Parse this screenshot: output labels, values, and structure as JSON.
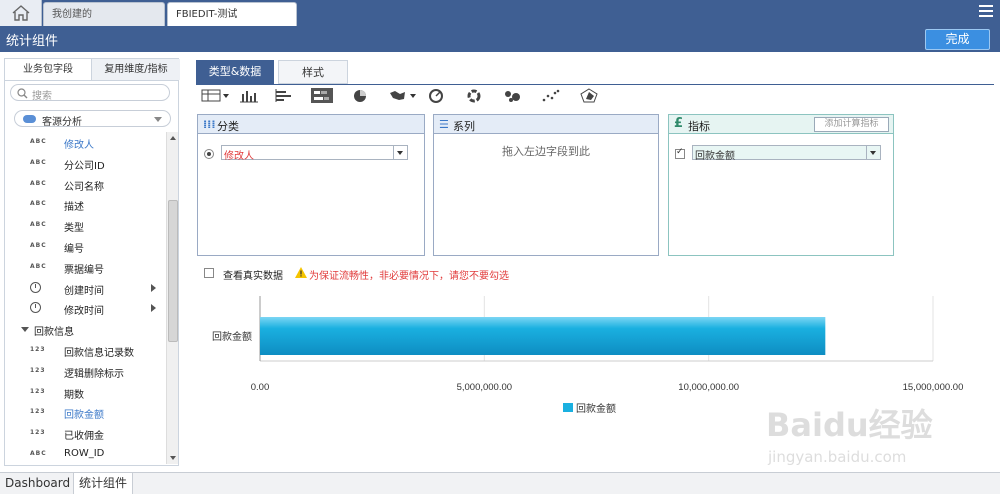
{
  "tabs": [
    {
      "label": "我创建的"
    },
    {
      "label": "FBIEDIT-测试"
    }
  ],
  "title": "统计组件",
  "done_label": "完成",
  "left": {
    "tabs": [
      "业务包字段",
      "复用维度/指标"
    ],
    "search_placeholder": "搜索",
    "package": "客源分析",
    "fields": [
      {
        "kind": "ABC",
        "name": "修改人",
        "highlight": true
      },
      {
        "kind": "ABC",
        "name": "分公司ID"
      },
      {
        "kind": "ABC",
        "name": "公司名称"
      },
      {
        "kind": "ABC",
        "name": "描述"
      },
      {
        "kind": "ABC",
        "name": "类型"
      },
      {
        "kind": "ABC",
        "name": "编号"
      },
      {
        "kind": "ABC",
        "name": "票据编号"
      },
      {
        "kind": "time",
        "name": "创建时间",
        "expand": true
      },
      {
        "kind": "time",
        "name": "修改时间",
        "expand": true
      },
      {
        "kind": "group",
        "name": "回款信息"
      },
      {
        "kind": "123",
        "name": "回款信息记录数"
      },
      {
        "kind": "123",
        "name": "逻辑删除标示"
      },
      {
        "kind": "123",
        "name": "期数"
      },
      {
        "kind": "123",
        "name": "回款金额",
        "highlight": true
      },
      {
        "kind": "123",
        "name": "已收佣金"
      },
      {
        "kind": "ABC",
        "name": "ROW_ID"
      }
    ]
  },
  "right": {
    "tabs": [
      "类型&数据",
      "样式"
    ],
    "chart_types": [
      "table-icon",
      "bar-chart-icon",
      "horizontal-bar-icon",
      "stacked-bar-icon",
      "pie-chart-icon",
      "map-icon",
      "gauge-icon",
      "donut-icon",
      "bubble-icon",
      "scatter-icon",
      "radar-icon"
    ],
    "category": {
      "title": "分类",
      "value": "修改人"
    },
    "series": {
      "title": "系列",
      "hint": "拖入左边字段到此"
    },
    "metric": {
      "title": "指标",
      "add_label": "添加计算指标",
      "value": "回款金额"
    },
    "real_data_label": "查看真实数据",
    "warning": "为保证流畅性，非必要情况下，请您不要勾选"
  },
  "chart_data": {
    "type": "bar",
    "orientation": "horizontal",
    "categories": [
      "回款金额"
    ],
    "series": [
      {
        "name": "回款金额",
        "values": [
          12600000
        ]
      }
    ],
    "xlim": [
      0,
      15000000
    ],
    "xticks": [
      "0.00",
      "5,000,000.00",
      "10,000,000.00",
      "15,000,000.00"
    ],
    "legend": "bottom",
    "color": "#1ab0e0"
  },
  "bottom_tabs": [
    "Dashboard",
    "统计组件"
  ],
  "watermark": {
    "brand": "Baidu经验",
    "url": "jingyan.baidu.com"
  }
}
